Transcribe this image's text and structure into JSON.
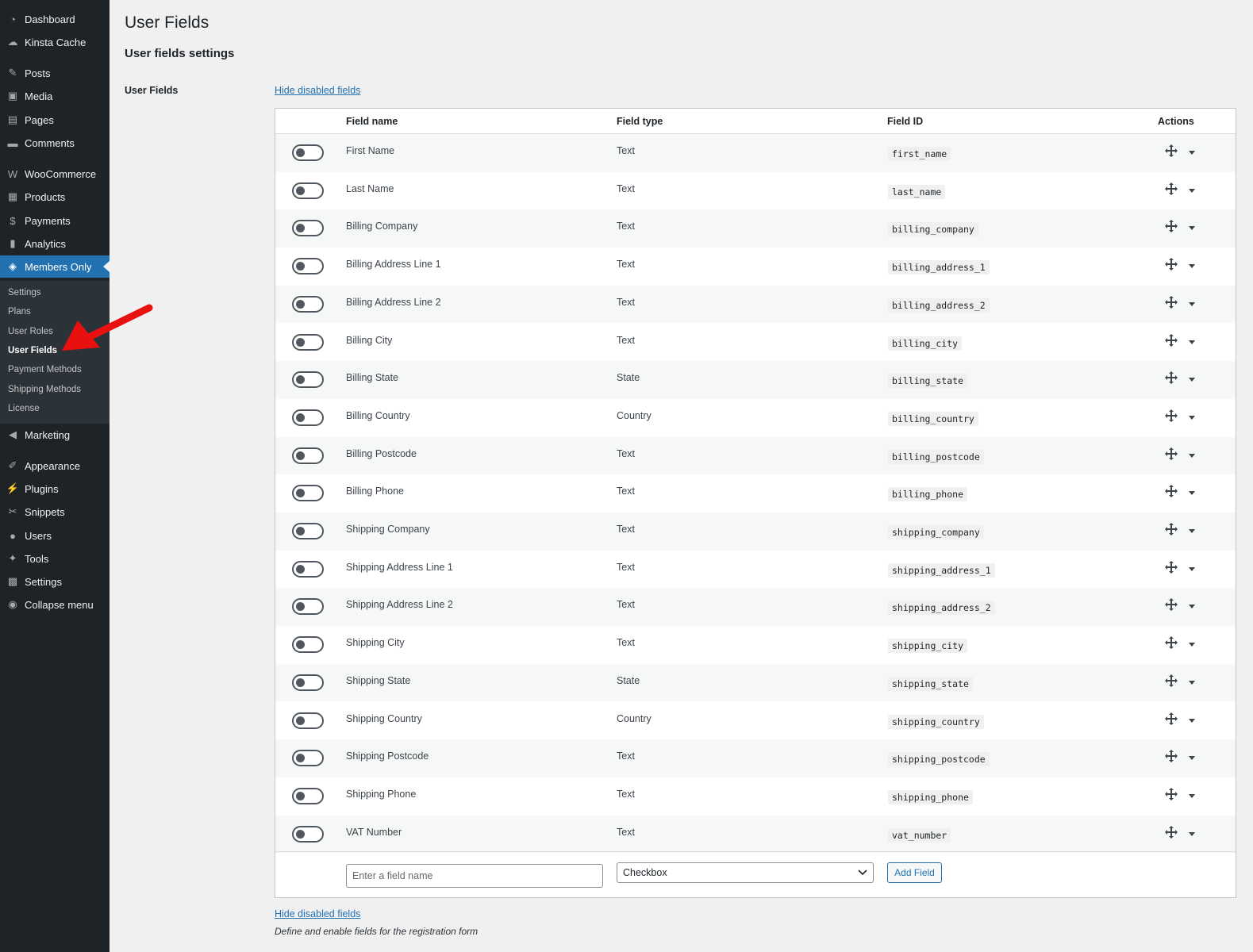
{
  "sidebar": {
    "items": [
      {
        "label": "Dashboard",
        "icon": "dashboard-icon"
      },
      {
        "label": "Kinsta Cache",
        "icon": "cloud-icon"
      },
      {
        "label": "Posts",
        "icon": "pin-icon"
      },
      {
        "label": "Media",
        "icon": "media-icon"
      },
      {
        "label": "Pages",
        "icon": "pages-icon"
      },
      {
        "label": "Comments",
        "icon": "comment-icon"
      },
      {
        "label": "WooCommerce",
        "icon": "woocommerce-icon"
      },
      {
        "label": "Products",
        "icon": "products-icon"
      },
      {
        "label": "Payments",
        "icon": "payments-icon"
      },
      {
        "label": "Analytics",
        "icon": "analytics-icon"
      },
      {
        "label": "Members Only",
        "icon": "shield-icon",
        "current": true
      },
      {
        "label": "Marketing",
        "icon": "megaphone-icon"
      },
      {
        "label": "Appearance",
        "icon": "brush-icon"
      },
      {
        "label": "Plugins",
        "icon": "plug-icon"
      },
      {
        "label": "Snippets",
        "icon": "scissors-icon"
      },
      {
        "label": "Users",
        "icon": "user-icon"
      },
      {
        "label": "Tools",
        "icon": "wrench-icon"
      },
      {
        "label": "Settings",
        "icon": "settings-icon"
      },
      {
        "label": "Collapse menu",
        "icon": "collapse-icon"
      }
    ],
    "submenu": [
      "Settings",
      "Plans",
      "User Roles",
      "User Fields",
      "Payment Methods",
      "Shipping Methods",
      "License"
    ],
    "submenu_active": "User Fields"
  },
  "page": {
    "title": "User Fields",
    "section_title": "User fields settings",
    "row_label": "User Fields",
    "hide_link": "Hide disabled fields",
    "help_text": "Define and enable fields for the registration form"
  },
  "table": {
    "headers": {
      "name": "Field name",
      "type": "Field type",
      "id": "Field ID",
      "actions": "Actions"
    },
    "rows": [
      {
        "name": "First Name",
        "type": "Text",
        "id": "first_name",
        "enabled": false
      },
      {
        "name": "Last Name",
        "type": "Text",
        "id": "last_name",
        "enabled": false
      },
      {
        "name": "Billing Company",
        "type": "Text",
        "id": "billing_company",
        "enabled": false
      },
      {
        "name": "Billing Address Line 1",
        "type": "Text",
        "id": "billing_address_1",
        "enabled": false
      },
      {
        "name": "Billing Address Line 2",
        "type": "Text",
        "id": "billing_address_2",
        "enabled": false
      },
      {
        "name": "Billing City",
        "type": "Text",
        "id": "billing_city",
        "enabled": false
      },
      {
        "name": "Billing State",
        "type": "State",
        "id": "billing_state",
        "enabled": false
      },
      {
        "name": "Billing Country",
        "type": "Country",
        "id": "billing_country",
        "enabled": false
      },
      {
        "name": "Billing Postcode",
        "type": "Text",
        "id": "billing_postcode",
        "enabled": false
      },
      {
        "name": "Billing Phone",
        "type": "Text",
        "id": "billing_phone",
        "enabled": false
      },
      {
        "name": "Shipping Company",
        "type": "Text",
        "id": "shipping_company",
        "enabled": false
      },
      {
        "name": "Shipping Address Line 1",
        "type": "Text",
        "id": "shipping_address_1",
        "enabled": false
      },
      {
        "name": "Shipping Address Line 2",
        "type": "Text",
        "id": "shipping_address_2",
        "enabled": false
      },
      {
        "name": "Shipping City",
        "type": "Text",
        "id": "shipping_city",
        "enabled": false
      },
      {
        "name": "Shipping State",
        "type": "State",
        "id": "shipping_state",
        "enabled": false
      },
      {
        "name": "Shipping Country",
        "type": "Country",
        "id": "shipping_country",
        "enabled": false
      },
      {
        "name": "Shipping Postcode",
        "type": "Text",
        "id": "shipping_postcode",
        "enabled": false
      },
      {
        "name": "Shipping Phone",
        "type": "Text",
        "id": "shipping_phone",
        "enabled": false
      },
      {
        "name": "VAT Number",
        "type": "Text",
        "id": "vat_number",
        "enabled": false
      }
    ]
  },
  "add_field": {
    "placeholder": "Enter a field name",
    "selected_type": "Checkbox",
    "button_label": "Add Field"
  },
  "colors": {
    "sidebar_bg": "#1d2327",
    "accent": "#2271b1",
    "arrow": "#e8110f"
  }
}
